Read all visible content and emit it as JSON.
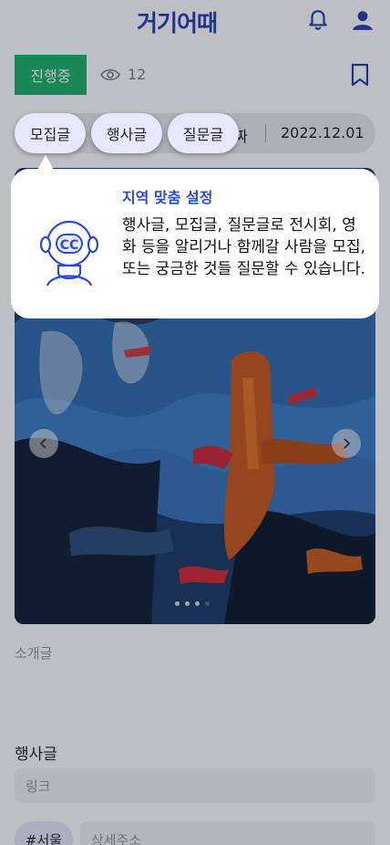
{
  "header": {
    "logo_text": "거기어때"
  },
  "status": {
    "badge": "진행중",
    "views": "12"
  },
  "categories": {
    "items": [
      "모집글",
      "행사글",
      "질문글"
    ]
  },
  "date": {
    "label_fragment": "짜",
    "value": "2022.12.01"
  },
  "tooltip": {
    "title": "지역 맞춤 설정",
    "body": "행사글, 모집글, 질문글로 전시회, 영화 등을 알리거나 함께갈 사람을 모집, 또는 궁금한 것들 질문할 수 있습니다."
  },
  "carousel": {
    "dot_count": 4,
    "active_index": 3
  },
  "form": {
    "intro_label": "소개글",
    "section_title": "행사글",
    "link_placeholder": "링크",
    "region_chip": "#서울",
    "address_placeholder": "상세주소"
  },
  "colors": {
    "brand": "#1f3fb8",
    "status_green": "#1bb26c",
    "chip_bg": "#e6e8ff",
    "accent": "#2a4bd6"
  }
}
